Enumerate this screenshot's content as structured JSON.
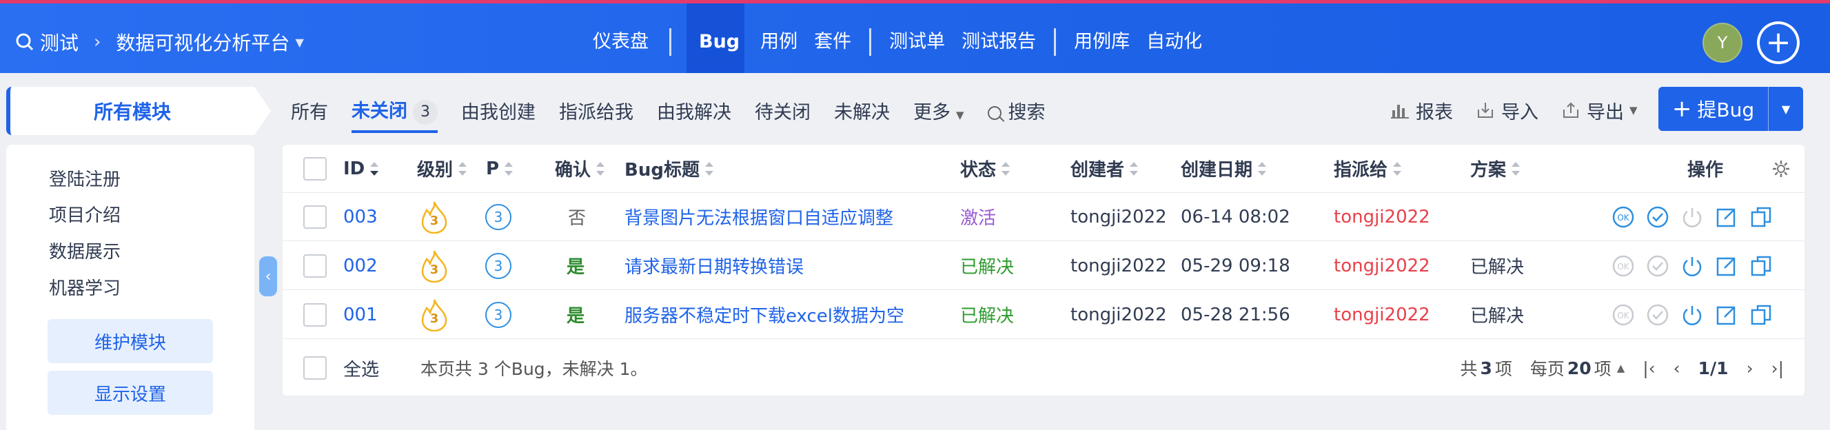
{
  "topbar": {
    "product": "测试",
    "project": "数据可视化分析平台",
    "nav": [
      "仪表盘",
      "Bug",
      "用例",
      "套件",
      "测试单",
      "测试报告",
      "用例库",
      "自动化"
    ],
    "avatar_letter": "Y"
  },
  "sidebar": {
    "title": "所有模块",
    "modules": [
      "登陆注册",
      "项目介绍",
      "数据展示",
      "机器学习"
    ],
    "maintain_button": "维护模块",
    "display_button": "显示设置"
  },
  "filters": {
    "all": "所有",
    "unclosed": "未关闭",
    "unclosed_count": "3",
    "created_by_me": "由我创建",
    "assigned_to_me": "指派给我",
    "resolved_by_me": "由我解决",
    "to_close": "待关闭",
    "unresolved": "未解决",
    "more": "更多",
    "search": "搜索"
  },
  "tools": {
    "report": "报表",
    "import": "导入",
    "export": "导出",
    "add_bug": "提Bug"
  },
  "table": {
    "headers": {
      "id": "ID",
      "severity": "级别",
      "pri": "P",
      "confirm": "确认",
      "title": "Bug标题",
      "status": "状态",
      "creator": "创建者",
      "date": "创建日期",
      "assigned": "指派给",
      "resolution": "方案",
      "actions": "操作"
    },
    "rows": [
      {
        "id": "003",
        "severity": "3",
        "pri": "3",
        "confirm": "否",
        "title": "背景图片无法根据窗口自适应调整",
        "status": "激活",
        "creator": "tongji2022",
        "date": "06-14 08:02",
        "assigned": "tongji2022",
        "resolution": ""
      },
      {
        "id": "002",
        "severity": "3",
        "pri": "3",
        "confirm": "是",
        "title": "请求最新日期转换错误",
        "status": "已解决",
        "creator": "tongji2022",
        "date": "05-29 09:18",
        "assigned": "tongji2022",
        "resolution": "已解决"
      },
      {
        "id": "001",
        "severity": "3",
        "pri": "3",
        "confirm": "是",
        "title": "服务器不稳定时下载excel数据为空",
        "status": "已解决",
        "creator": "tongji2022",
        "date": "05-28 21:56",
        "assigned": "tongji2022",
        "resolution": "已解决"
      }
    ]
  },
  "footer": {
    "select_all": "全选",
    "summary": "本页共 3 个Bug，未解决 1。",
    "total_prefix": "共",
    "total": "3",
    "total_suffix": "项",
    "per_page_prefix": "每页",
    "per_page": "20",
    "per_page_suffix": "项",
    "page": "1/1"
  },
  "colors": {
    "primary": "#1f63e8",
    "status_active": "#9a5bd6",
    "status_resolved": "#2e9b2e",
    "assignee": "#e8414a",
    "severity_flame": "#f5b41e"
  }
}
